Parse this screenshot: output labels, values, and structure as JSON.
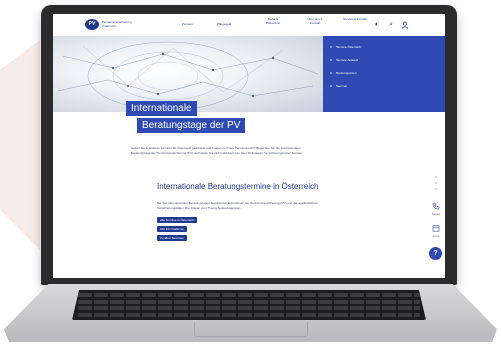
{
  "header": {
    "logo_mark": "PV",
    "logo_text_line1": "Pensionsversicherung",
    "logo_text_line2": "Österreich",
    "nav": [
      {
        "label": "Pension"
      },
      {
        "label": "Pflegegeld"
      },
      {
        "label": "Reha & Prävention"
      },
      {
        "label": "Über uns & Kontakt"
      },
      {
        "label": "Service & Kontakt"
      }
    ],
    "icons": [
      "contrast-icon",
      "search-icon",
      "user-icon"
    ]
  },
  "sub_nav": {
    "items": [
      {
        "label": "Termine Österreich"
      },
      {
        "label": "Termine Ausland"
      },
      {
        "label": "Beratungsorten"
      },
      {
        "label": "Seminar"
      }
    ]
  },
  "page": {
    "title_line1": "Internationale",
    "title_line2": "Beratungstage der PV",
    "intro": "Haben Sie in anderen Ländern als Österreich gearbeitet und Fragen zu Ihrem Pensionsrecht? Besuchen Sie die Internationalen Beratungstage der Pensionsversicherung (PV) und lassen Sie sich individuell zum Ihrer Drittstaaten Versicherungszeiten beraten.",
    "section_heading": "Internationale Beratungstermine in Österreich",
    "section_text": "Bei den Internationalen Beratungstagen beantworten Expertinnen der Pensionsversicherung (PV) und der ausländischen Versicherungsträger Ihre Fragen zum Thema Auslandspension.",
    "buttons": [
      {
        "label": "Alle Termine in Österreich"
      },
      {
        "label": "Alle Informationen"
      },
      {
        "label": "Zu allen Terminen"
      }
    ]
  },
  "side_tools": {
    "items": [
      {
        "icon": "phone-icon",
        "label": "Kontakt"
      },
      {
        "icon": "calendar-icon",
        "label": "Termin"
      }
    ],
    "fab_icon": "help-icon",
    "fab_symbol": "?"
  },
  "colors": {
    "brand_blue": "#2f4bb3",
    "dark_blue": "#1f3b8f"
  }
}
